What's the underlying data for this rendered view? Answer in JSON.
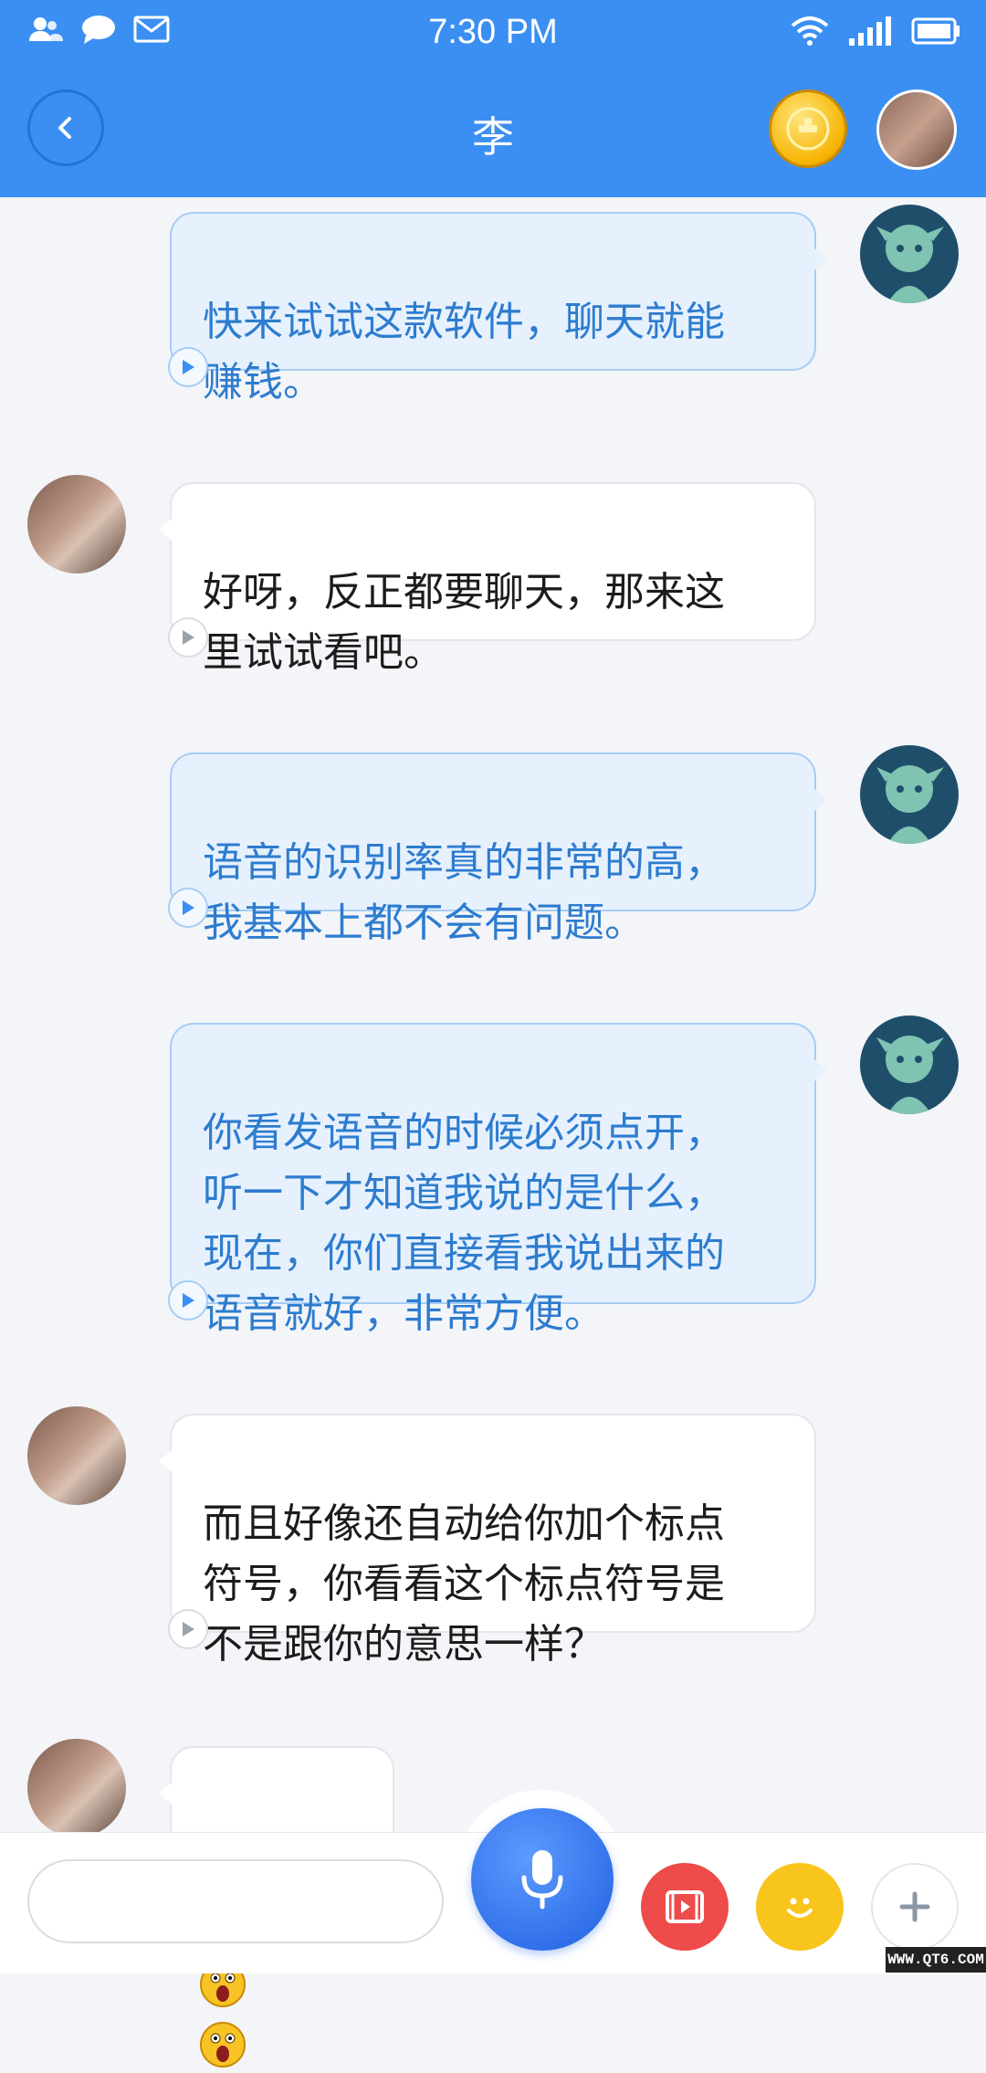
{
  "status_bar": {
    "time": "7:30 PM",
    "icons": [
      "contacts-icon",
      "chat-icon",
      "mail-icon",
      "wifi-icon",
      "signal-icon",
      "battery-icon"
    ]
  },
  "header": {
    "title": "李",
    "icons": [
      "back-icon",
      "coin-icon"
    ]
  },
  "messages": [
    {
      "side": "out",
      "text": "快来试试这款软件，聊天就能\n赚钱。"
    },
    {
      "side": "in",
      "text": "好呀，反正都要聊天，那来这\n里试试看吧。"
    },
    {
      "side": "out",
      "text": "语音的识别率真的非常的高，\n我基本上都不会有问题。"
    },
    {
      "side": "out",
      "text": "你看发语音的时候必须点开，\n听一下才知道我说的是什么，\n现在，你们直接看我说出来的\n语音就好，非常方便。"
    },
    {
      "side": "in",
      "text": "而且好像还自动给你加个标点\n符号，你看看这个标点符号是\n不是跟你的意思一样？"
    },
    {
      "side": "in",
      "emojis": [
        "scream-emoji",
        "scream-emoji",
        "scream-emoji"
      ]
    }
  ],
  "input_bar": {
    "text_value": "",
    "buttons": [
      "mic-icon",
      "video-icon",
      "smile-icon",
      "plus-icon"
    ]
  },
  "watermark": "WWW.QT6.COM",
  "colors": {
    "header_bg": "#3b8ff2",
    "out_bubble_bg": "#e6f1fd",
    "out_text": "#2d7ccf",
    "in_bubble_bg": "#ffffff",
    "mic": "#2f6ee8",
    "video": "#ee4b4b",
    "emoji_btn": "#f8c51c"
  }
}
